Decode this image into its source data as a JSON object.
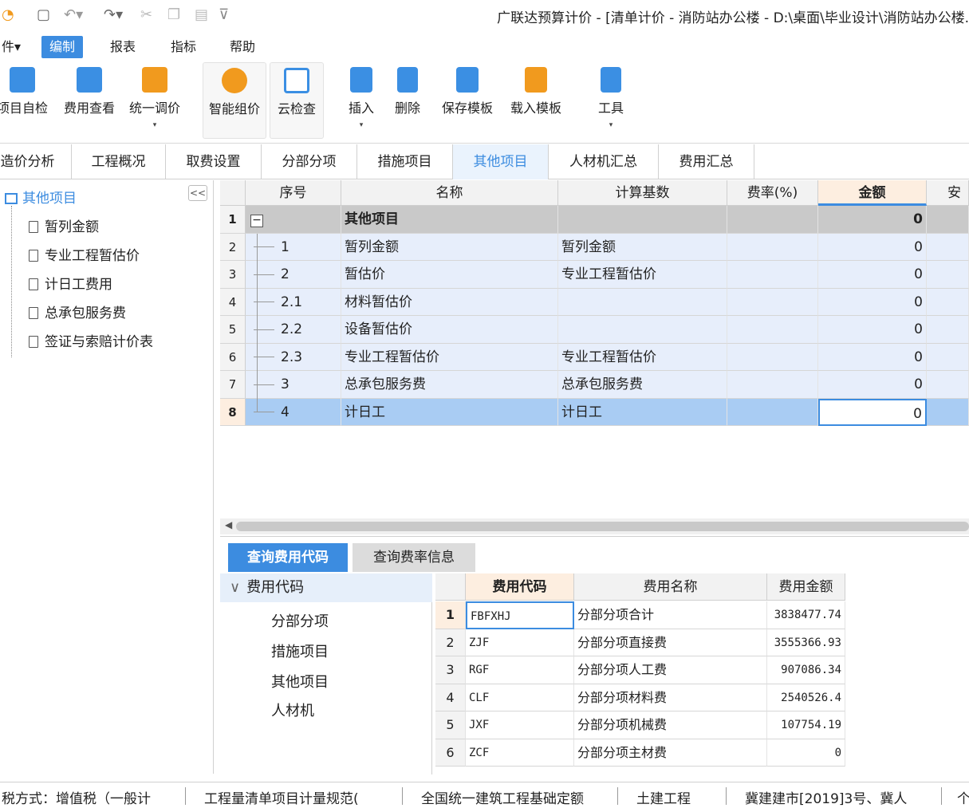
{
  "title": "广联达预算计价 - [清单计价 - 消防站办公楼 - D:\\桌面\\毕业设计\\消防站办公楼.",
  "menu": [
    {
      "label": "件▾"
    },
    {
      "label": "编制"
    },
    {
      "label": "报表"
    },
    {
      "label": "指标"
    },
    {
      "label": "帮助"
    }
  ],
  "ribbon": [
    {
      "label": "项目自检",
      "arrow": ""
    },
    {
      "label": "费用查看",
      "arrow": ""
    },
    {
      "label": "统一调价",
      "arrow": "▾"
    },
    {
      "label": "智能组价",
      "arrow": ""
    },
    {
      "label": "云检查",
      "arrow": ""
    },
    {
      "label": "插入",
      "arrow": "▾"
    },
    {
      "label": "删除",
      "arrow": ""
    },
    {
      "label": "保存模板",
      "arrow": ""
    },
    {
      "label": "载入模板",
      "arrow": ""
    },
    {
      "label": "工具",
      "arrow": "▾"
    }
  ],
  "tabs": [
    {
      "label": "造价分析"
    },
    {
      "label": "工程概况"
    },
    {
      "label": "取费设置"
    },
    {
      "label": "分部分项"
    },
    {
      "label": "措施项目"
    },
    {
      "label": "其他项目"
    },
    {
      "label": "人材机汇总"
    },
    {
      "label": "费用汇总"
    }
  ],
  "tree": {
    "root": "其他项目",
    "collapse": "<<",
    "children": [
      "暂列金额",
      "专业工程暂估价",
      "计日工费用",
      "总承包服务费",
      "签证与索赔计价表"
    ]
  },
  "grid": {
    "headers": [
      "序号",
      "名称",
      "计算基数",
      "费率(%)",
      "金额",
      "安"
    ],
    "rows": [
      {
        "n": "1",
        "seq": "",
        "name": "其他项目",
        "base": "",
        "rate": "",
        "amount": "0"
      },
      {
        "n": "2",
        "seq": "1",
        "name": "暂列金额",
        "base": "暂列金额",
        "rate": "",
        "amount": "0"
      },
      {
        "n": "3",
        "seq": "2",
        "name": "暂估价",
        "base": "专业工程暂估价",
        "rate": "",
        "amount": "0"
      },
      {
        "n": "4",
        "seq": "2.1",
        "name": "材料暂估价",
        "base": "",
        "rate": "",
        "amount": "0"
      },
      {
        "n": "5",
        "seq": "2.2",
        "name": "设备暂估价",
        "base": "",
        "rate": "",
        "amount": "0"
      },
      {
        "n": "6",
        "seq": "2.3",
        "name": "专业工程暂估价",
        "base": "专业工程暂估价",
        "rate": "",
        "amount": "0"
      },
      {
        "n": "7",
        "seq": "3",
        "name": "总承包服务费",
        "base": "总承包服务费",
        "rate": "",
        "amount": "0"
      },
      {
        "n": "8",
        "seq": "4",
        "name": "计日工",
        "base": "计日工",
        "rate": "",
        "amount": "0"
      }
    ]
  },
  "lower": {
    "tabs": [
      "查询费用代码",
      "查询费率信息"
    ],
    "tree_head": "费用代码",
    "tree_items": [
      "分部分项",
      "措施项目",
      "其他项目",
      "人材机"
    ],
    "headers": [
      "费用代码",
      "费用名称",
      "费用金额"
    ],
    "rows": [
      {
        "n": "1",
        "code": "FBFXHJ",
        "name": "分部分项合计",
        "amount": "3838477.74"
      },
      {
        "n": "2",
        "code": "ZJF",
        "name": "分部分项直接费",
        "amount": "3555366.93"
      },
      {
        "n": "3",
        "code": "RGF",
        "name": "分部分项人工费",
        "amount": "907086.34"
      },
      {
        "n": "4",
        "code": "CLF",
        "name": "分部分项材料费",
        "amount": "2540526.4"
      },
      {
        "n": "5",
        "code": "JXF",
        "name": "分部分项机械费",
        "amount": "107754.19"
      },
      {
        "n": "6",
        "code": "ZCF",
        "name": "分部分项主材费",
        "amount": "0"
      }
    ]
  },
  "status": [
    "税方式：增值税（一般计",
    "工程量清单项目计量规范(",
    "全国统一建筑工程基础定额",
    "土建工程",
    "冀建建市[2019]3号、冀人",
    "个"
  ]
}
